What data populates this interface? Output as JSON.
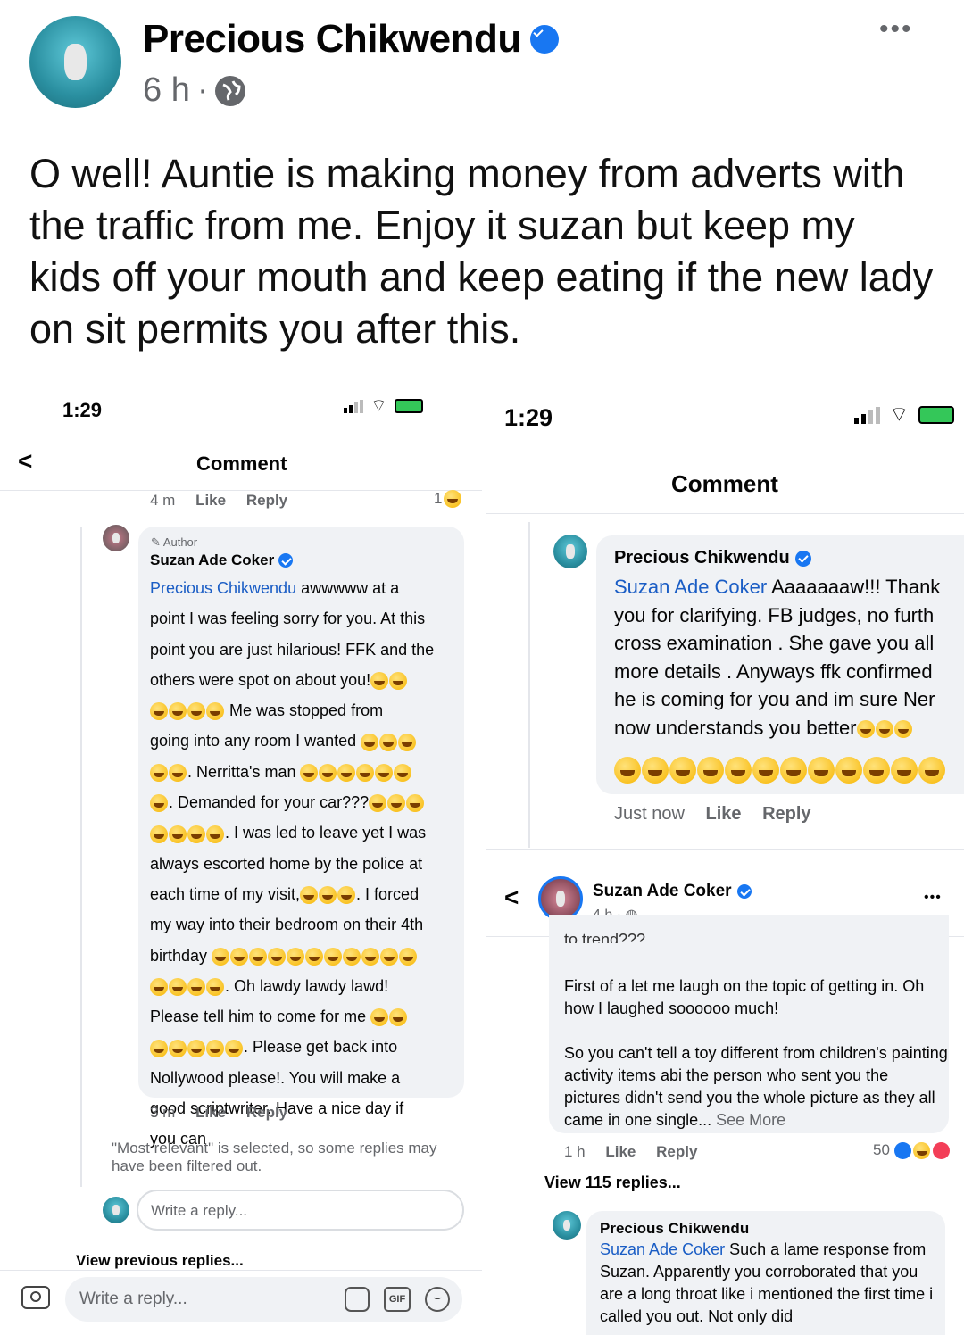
{
  "post": {
    "author": "Precious Chikwendu",
    "time": "6 h",
    "sep": "·",
    "more": "•••",
    "text": "O well! Auntie is making money from adverts with the traffic from me. Enjoy it suzan but keep my kids off your mouth and keep eating if the new lady on sit permits you after this."
  },
  "left": {
    "status_time": "1:29",
    "back": "<",
    "title": "Comment",
    "top_meta": {
      "time": "4 m",
      "like": "Like",
      "reply": "Reply",
      "count": "1"
    },
    "comment": {
      "badge": "Author",
      "author": "Suzan Ade Coker",
      "lines": [
        {
          "link": "Precious Chikwendu",
          "text": " awwwww at a"
        },
        {
          "text": "point I was feeling sorry for you. At this"
        },
        {
          "text": "point you are just hilarious! FFK and the"
        },
        {
          "text": "others were spot on about you!",
          "emoji": 2
        },
        {
          "emoji_before": 4,
          "text": " Me was stopped from"
        },
        {
          "text": "going into any room I wanted ",
          "emoji": 3
        },
        {
          "emoji_before": 2,
          "text": ". Nerritta's man ",
          "emoji": 6
        },
        {
          "emoji_before": 1,
          "text": ". Demanded for your car???",
          "emoji": 3
        },
        {
          "emoji_before": 4,
          "text": ". I was led to leave yet I was"
        },
        {
          "text": "always escorted home by the police at"
        },
        {
          "text": "each time of my visit,",
          "emoji": 3,
          "tail": ". I forced"
        },
        {
          "text": "my way into their bedroom on their 4th"
        },
        {
          "text": "birthday ",
          "emoji": 11
        },
        {
          "emoji_before": 4,
          "text": ". Oh lawdy lawdy lawd!"
        },
        {
          "text": "Please tell him to come for me ",
          "emoji": 2
        },
        {
          "emoji_before": 5,
          "text": ". Please get back into"
        },
        {
          "text": "Nollywood please!. You will make a"
        },
        {
          "text": "good scriptwriter. Have a nice day if"
        },
        {
          "text": "you can"
        }
      ]
    },
    "comment_meta": {
      "time": "3 m",
      "like": "Like",
      "reply": "Reply"
    },
    "filter_note": "\"Most relevant\" is selected, so some replies may have been filtered out.",
    "reply_placeholder": "Write a reply...",
    "view_previous": "View previous replies...",
    "bottom_placeholder": "Write a reply...",
    "gif_label": "GIF"
  },
  "right": {
    "status_time": "1:29",
    "title": "Comment",
    "comment1": {
      "author": "Precious Chikwendu",
      "lines": [
        {
          "link": "Suzan Ade Coker",
          "text": " Aaaaaaaw!!! Thank"
        },
        {
          "text": "you for clarifying. FB judges, no furth"
        },
        {
          "text": "cross examination . She gave you all"
        },
        {
          "text": "more details . Anyways ffk confirmed"
        },
        {
          "text": "he is coming for you and im sure Ner"
        },
        {
          "text": "now understands you better",
          "emoji": 3
        }
      ],
      "emoji_row": 12
    },
    "comment1_meta": {
      "time": "Just now",
      "like": "Like",
      "reply": "Reply"
    },
    "header": {
      "back": "<",
      "author": "Suzan Ade Coker",
      "time": "4 h",
      "more": "•••"
    },
    "cut_line": "to trend???",
    "body1": "First of a let me laugh on the topic of getting in. Oh how I laughed soooooo much!",
    "body2": "So you can't tell a toy different from children's painting activity items abi the person who sent you the pictures didn't send you the whole picture as they all came in one single...",
    "see_more": "See More",
    "body_meta": {
      "time": "1 h",
      "like": "Like",
      "reply": "Reply",
      "count": "50"
    },
    "view_replies": "View 115 replies...",
    "comment2": {
      "author": "Precious Chikwendu",
      "link": "Suzan Ade Coker",
      "text": " Such a lame response from Suzan. Apparently you corroborated that you are a long throat like i mentioned the first time i called you out. Not only did"
    }
  },
  "colors": {
    "accent": "#1877f2",
    "link": "#1a5dc5",
    "meta": "#65676b",
    "bubble": "#f0f2f5"
  }
}
